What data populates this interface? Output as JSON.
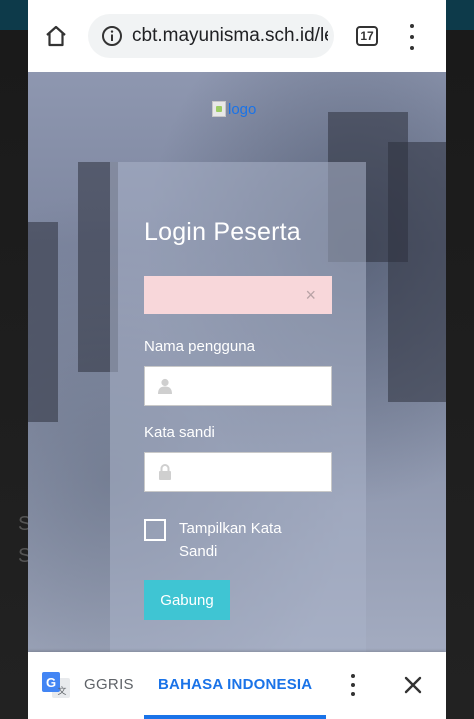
{
  "browser": {
    "url": "cbt.mayunisma.sch.id/lé",
    "tab_count": "17",
    "icons": {
      "home": "home-icon",
      "info": "info-icon",
      "menu": "more-vert-icon"
    }
  },
  "background": {
    "ghost_text": "S\nS"
  },
  "page": {
    "logo_alt": "logo",
    "title": "Login Peserta",
    "alert_close": "×",
    "username": {
      "label": "Nama pengguna",
      "value": "",
      "placeholder": "",
      "icon": "user-icon"
    },
    "password": {
      "label": "Kata sandi",
      "value": "",
      "placeholder": "",
      "icon": "lock-icon"
    },
    "show_password_label": "Tampilkan Kata Sandi",
    "show_password_checked": false,
    "submit_label": "Gabung"
  },
  "translate_bar": {
    "icon": "google-translate-icon",
    "lang_inactive": "GGRIS",
    "lang_active": "BAHASA INDONESIA",
    "menu_icon": "more-vert-icon",
    "close_icon": "close-icon"
  },
  "colors": {
    "accent": "#1a73e8",
    "submit": "#3fc5d3",
    "alert": "#f8d7da"
  }
}
